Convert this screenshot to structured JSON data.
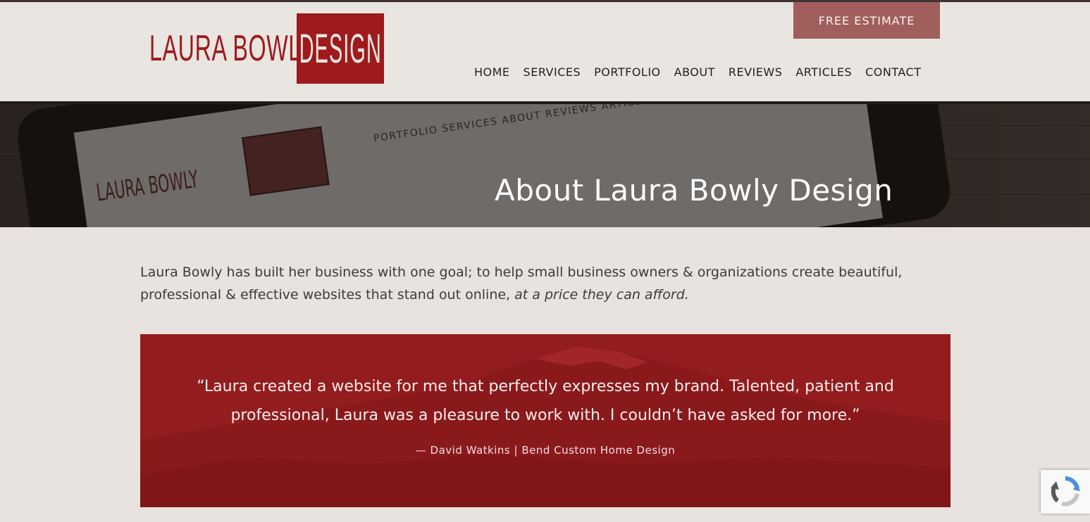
{
  "header": {
    "logo_left": "LAURA BOWLY",
    "logo_right": "DESIGN",
    "estimate_label": "FREE ESTIMATE",
    "nav": [
      "HOME",
      "SERVICES",
      "PORTFOLIO",
      "ABOUT",
      "REVIEWS",
      "ARTICLES",
      "CONTACT"
    ]
  },
  "hero": {
    "title": "About Laura Bowly Design",
    "screen_nav": "PORTFOLIO  SERVICES  ABOUT  REVIEWS  ARTICLES  CONTACT"
  },
  "intro": {
    "text": "Laura Bowly has built her business with one goal; to help small business owners & organizations create beautiful, professional & effective websites that stand out online,",
    "emphasis": "at a price they can afford."
  },
  "testimonial": {
    "quote": "“Laura created a website for me that perfectly expresses my brand. Talented, patient and professional, Laura was a pleasure to work with. I couldn’t have asked for more.”",
    "attribution": "— David Watkins | Bend Custom Home Design"
  },
  "colors": {
    "brand_red": "#9e1a1c",
    "estimate_button": "#a05e5c",
    "testimonial_bg": "#931c1e",
    "page_bg": "#e8e3de"
  },
  "icons": {
    "recaptcha": "recaptcha-icon"
  }
}
